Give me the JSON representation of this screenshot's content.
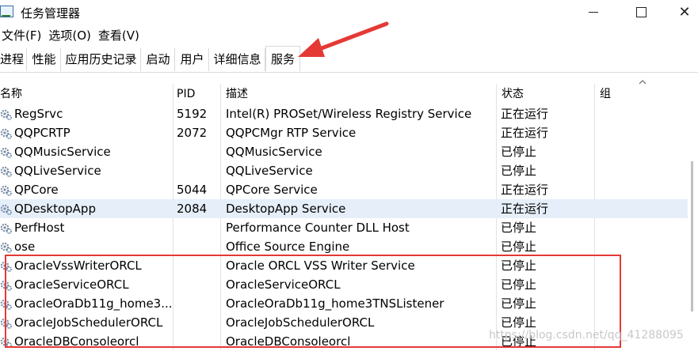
{
  "window": {
    "title": "任务管理器",
    "min_icon": "minimize-icon",
    "max_icon": "maximize-icon",
    "close_icon": "close-icon",
    "close_glyph": "✕"
  },
  "menu": [
    "文件(F)",
    "选项(O)",
    "查看(V)"
  ],
  "tabs": [
    "进程",
    "性能",
    "应用历史记录",
    "启动",
    "用户",
    "详细信息",
    "服务"
  ],
  "active_tab": "服务",
  "columns": {
    "name": "名称",
    "pid": "PID",
    "desc": "描述",
    "status": "状态",
    "group": "组"
  },
  "rows": [
    {
      "name": "RegSrvc",
      "pid": "5192",
      "desc": "Intel(R) PROSet/Wireless Registry Service",
      "status": "正在运行"
    },
    {
      "name": "QQPCRTP",
      "pid": "2072",
      "desc": "QQPCMgr RTP Service",
      "status": "正在运行"
    },
    {
      "name": "QQMusicService",
      "pid": "",
      "desc": "QQMusicService",
      "status": "已停止"
    },
    {
      "name": "QQLiveService",
      "pid": "",
      "desc": "QQLiveService",
      "status": "已停止"
    },
    {
      "name": "QPCore",
      "pid": "5044",
      "desc": "QPCore Service",
      "status": "正在运行"
    },
    {
      "name": "QDesktopApp",
      "pid": "2084",
      "desc": "DesktopApp Service",
      "status": "正在运行",
      "selected": true
    },
    {
      "name": "PerfHost",
      "pid": "",
      "desc": "Performance Counter DLL Host",
      "status": "已停止"
    },
    {
      "name": "ose",
      "pid": "",
      "desc": "Office Source Engine",
      "status": "已停止"
    },
    {
      "name": "OracleVssWriterORCL",
      "pid": "",
      "desc": "Oracle ORCL VSS Writer Service",
      "status": "已停止"
    },
    {
      "name": "OracleServiceORCL",
      "pid": "",
      "desc": "OracleServiceORCL",
      "status": "已停止"
    },
    {
      "name": "OracleOraDb11g_home3...",
      "pid": "",
      "desc": "OracleOraDb11g_home3TNSListener",
      "status": "已停止"
    },
    {
      "name": "OracleJobSchedulerORCL",
      "pid": "",
      "desc": "OracleJobSchedulerORCL",
      "status": "已停止"
    },
    {
      "name": "OracleDBConsoleorcl",
      "pid": "",
      "desc": "OracleDBConsoleorcl",
      "status": "已停止"
    }
  ],
  "watermark": "https://blog.csdn.net/qq_41288095",
  "colors": {
    "annotation": "#e53935",
    "selected_row": "#e6eff9"
  },
  "service_icon": "gear-icon"
}
